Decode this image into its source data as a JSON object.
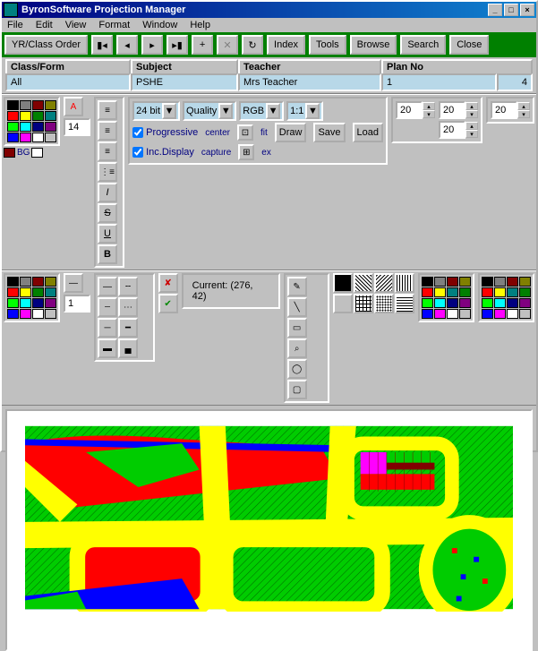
{
  "window": {
    "title": "ByronSoftware Projection Manager"
  },
  "menu": {
    "file": "File",
    "edit": "Edit",
    "view": "View",
    "format": "Format",
    "window": "Window",
    "help": "Help"
  },
  "toolbar1": {
    "order": "YR/Class Order",
    "index": "Index",
    "tools": "Tools",
    "browse": "Browse",
    "search": "Search",
    "close": "Close"
  },
  "fields": {
    "classform": {
      "label": "Class/Form",
      "value": "All"
    },
    "subject": {
      "label": "Subject",
      "value": "PSHE"
    },
    "teacher": {
      "label": "Teacher",
      "value": "Mrs Teacher"
    },
    "planno": {
      "label": "Plan No",
      "value": "1",
      "extra": "4"
    }
  },
  "fontsize": "14",
  "bitdepth": "24 bit",
  "quality": "Quality",
  "colormode": "RGB",
  "ratio": "1:1",
  "spin": {
    "a": "20",
    "b": "20",
    "c": "20",
    "d": "20"
  },
  "opts": {
    "progressive": "Progressive",
    "incdisplay": "Inc.Display",
    "center": "center",
    "capture": "capture",
    "fit": "fit",
    "ex": "ex"
  },
  "actions": {
    "draw": "Draw",
    "save": "Save",
    "load": "Load"
  },
  "linewidth": "1",
  "status": "Current: (276, 42)",
  "palette1": [
    "#000",
    "#808080",
    "#800000",
    "#808000",
    "#f00",
    "#ff0",
    "#008000",
    "#008080",
    "#0f0",
    "#0ff",
    "#000080",
    "#800080",
    "#00f",
    "#f0f",
    "#fff",
    "#c0c0c0"
  ],
  "palette2": [
    "#000",
    "#808080",
    "#800000",
    "#808000",
    "#f00",
    "#ff0",
    "#008000",
    "#008080",
    "#0f0",
    "#0ff",
    "#000080",
    "#800080",
    "#00f",
    "#f0f",
    "#fff",
    "#c0c0c0"
  ],
  "palette3": [
    "#000",
    "#808080",
    "#800000",
    "#808000",
    "#f00",
    "#ff0",
    "#008080",
    "#008000",
    "#0f0",
    "#0ff",
    "#000080",
    "#800080",
    "#00f",
    "#f0f",
    "#fff",
    "#c0c0c0"
  ],
  "palette4": [
    "#000",
    "#808080",
    "#800000",
    "#808000",
    "#f00",
    "#ff0",
    "#008080",
    "#008000",
    "#0f0",
    "#0ff",
    "#000080",
    "#800080",
    "#00f",
    "#f0f",
    "#fff",
    "#c0c0c0"
  ],
  "bglabel": "BG"
}
